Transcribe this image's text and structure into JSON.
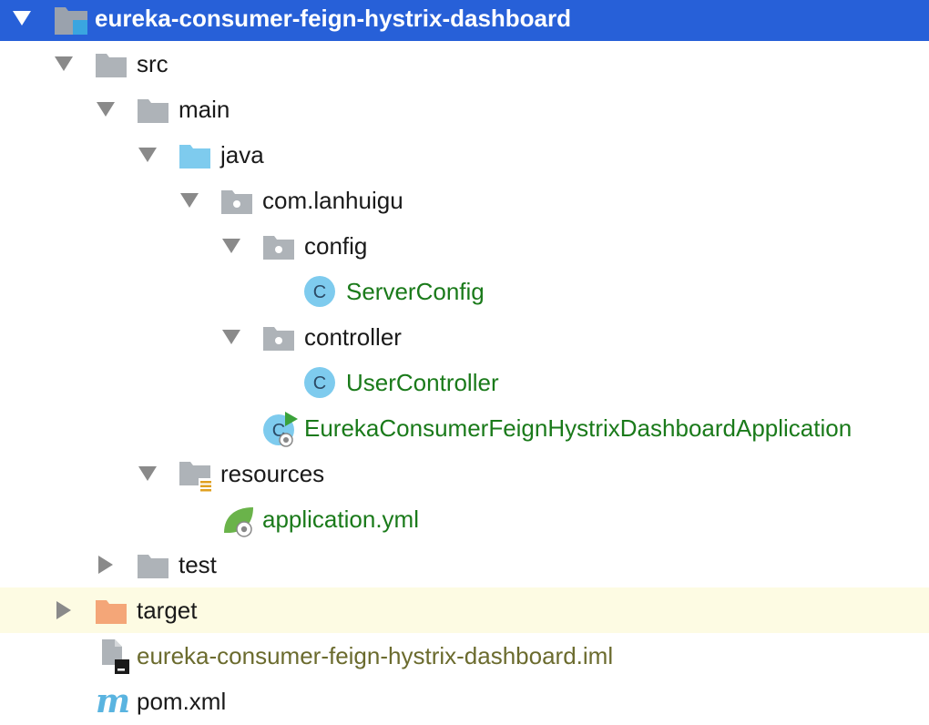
{
  "tree": {
    "root": {
      "label": "eureka-consumer-feign-hystrix-dashboard",
      "icon": "module-folder-icon"
    },
    "src": {
      "label": "src",
      "icon": "folder-icon"
    },
    "main": {
      "label": "main",
      "icon": "folder-icon"
    },
    "java": {
      "label": "java",
      "icon": "source-root-folder-icon"
    },
    "package_root": {
      "label": "com.lanhuigu",
      "icon": "package-icon"
    },
    "config": {
      "label": "config",
      "icon": "package-icon"
    },
    "server_config": {
      "label": "ServerConfig",
      "icon": "java-class-icon"
    },
    "controller": {
      "label": "controller",
      "icon": "package-icon"
    },
    "user_controller": {
      "label": "UserController",
      "icon": "java-class-icon"
    },
    "application_class": {
      "label": "EurekaConsumerFeignHystrixDashboardApplication",
      "icon": "spring-boot-run-class-icon"
    },
    "resources": {
      "label": "resources",
      "icon": "resources-folder-icon"
    },
    "application_yml": {
      "label": "application.yml",
      "icon": "spring-yaml-icon"
    },
    "test": {
      "label": "test",
      "icon": "folder-icon"
    },
    "target": {
      "label": "target",
      "icon": "excluded-folder-icon"
    },
    "iml": {
      "label": "eureka-consumer-feign-hystrix-dashboard.iml",
      "icon": "iml-file-icon"
    },
    "pom": {
      "label": "pom.xml",
      "icon": "maven-icon"
    }
  },
  "colors": {
    "selection": "#2760d8",
    "highlight_row": "#fdfbe3",
    "class_text": "#1a7a1a",
    "iml_text": "#6b6b2e",
    "folder_gray": "#aeb3b8",
    "source_folder_blue": "#7ecbee",
    "excluded_folder_orange": "#f4a678"
  }
}
